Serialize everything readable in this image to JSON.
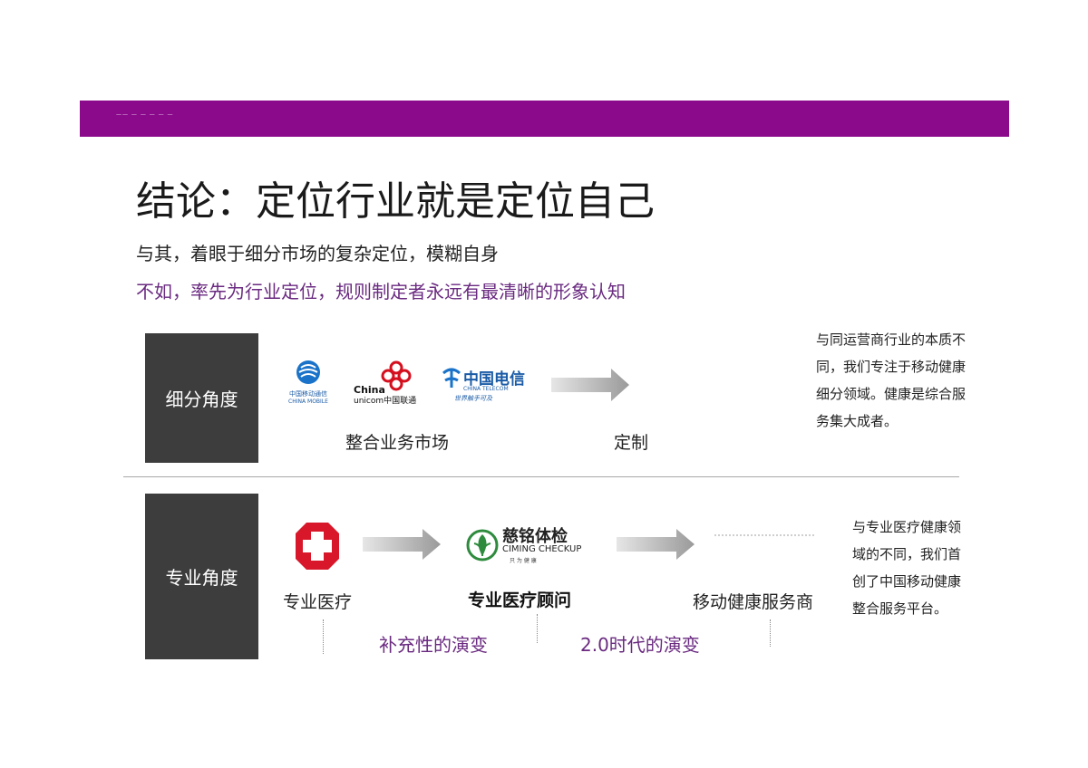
{
  "banner": {
    "text": "—— — — — — —"
  },
  "title": "结论：定位行业就是定位自己",
  "subtitle_line1": "与其，着眼于细分市场的复杂定位，模糊自身",
  "subtitle_line2": "不如，率先为行业定位，规则制定者永远有最清晰的形象认知",
  "row1": {
    "category": "细分角度",
    "logos": {
      "china_mobile_cn": "中国移动通信",
      "china_mobile_en": "CHINA MOBILE",
      "unicom_en1": "China",
      "unicom_en2": "unicom中国联通",
      "telecom_cn": "中国电信",
      "telecom_en": "CHINA TELECOM",
      "telecom_slogan": "世界触手可及"
    },
    "integrate_label": "整合业务市场",
    "custom_label": "定制",
    "side_text": "与同运营商行业的本质不同，我们专注于移动健康细分领域。健康是综合服务集大成者。"
  },
  "row2": {
    "category": "专业角度",
    "step1_label": "专业医疗",
    "ciming_cn": "慈铭体检",
    "ciming_en": "CIMING CHECKUP",
    "ciming_small": "只 为 健 康",
    "step2_label": "专业医疗顾问",
    "step3_label": "移动健康服务商",
    "evolution1": "补充性的演变",
    "evolution2": "2.0时代的演变",
    "side_text": "与专业医疗健康领域的不同，我们首创了中国移动健康整合服务平台。"
  },
  "colors": {
    "banner": "#8b0a8c",
    "purple_text": "#6a2a80",
    "dark_box": "#3d3d3d"
  }
}
